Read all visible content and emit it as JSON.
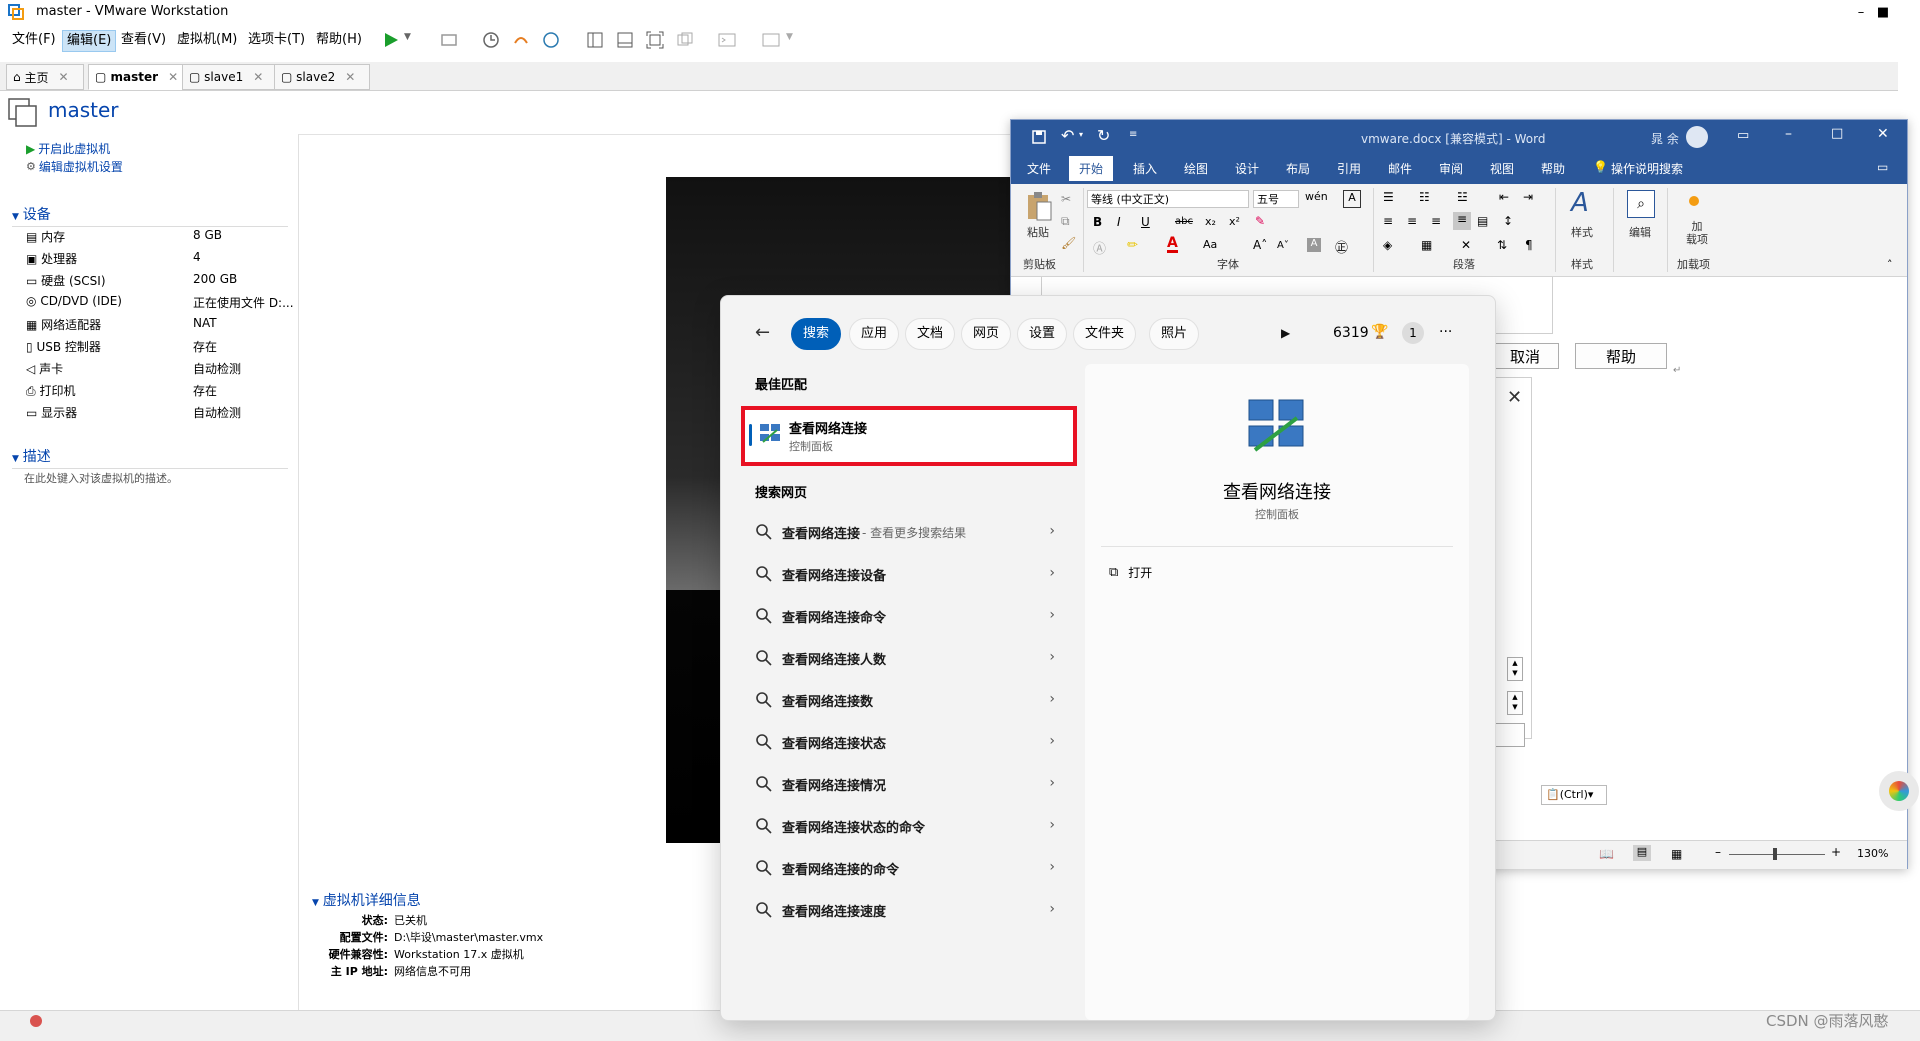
{
  "vmware": {
    "title": "master - VMware Workstation",
    "menu": [
      "文件(F)",
      "编辑(E)",
      "查看(V)",
      "虚拟机(M)",
      "选项卡(T)",
      "帮助(H)"
    ],
    "tabs": [
      "主页",
      "master",
      "slave1",
      "slave2"
    ],
    "vm_name": "master",
    "actions": [
      "开启此虚拟机",
      "编辑虚拟机设置"
    ],
    "devices_title": "设备",
    "devices": [
      {
        "name": "内存",
        "value": "8 GB"
      },
      {
        "name": "处理器",
        "value": "4"
      },
      {
        "name": "硬盘 (SCSI)",
        "value": "200 GB"
      },
      {
        "name": "CD/DVD (IDE)",
        "value": "正在使用文件 D:..."
      },
      {
        "name": "网络适配器",
        "value": "NAT"
      },
      {
        "name": "USB 控制器",
        "value": "存在"
      },
      {
        "name": "声卡",
        "value": "自动检测"
      },
      {
        "name": "打印机",
        "value": "存在"
      },
      {
        "name": "显示器",
        "value": "自动检测"
      }
    ],
    "desc_title": "描述",
    "desc_placeholder": "在此处键入对该虚拟机的描述。",
    "details_title": "虚拟机详细信息",
    "details": [
      {
        "label": "状态:",
        "value": "已关机"
      },
      {
        "label": "配置文件:",
        "value": "D:\\毕设\\master\\master.vmx"
      },
      {
        "label": "硬件兼容性:",
        "value": "Workstation 17.x 虚拟机"
      },
      {
        "label": "主 IP 地址:",
        "value": "网络信息不可用"
      }
    ]
  },
  "word": {
    "title": "vmware.docx [兼容模式] - Word",
    "user": "晁 余",
    "tabs": [
      "文件",
      "开始",
      "插入",
      "绘图",
      "设计",
      "布局",
      "引用",
      "邮件",
      "审阅",
      "视图",
      "帮助"
    ],
    "tell_me": "操作说明搜索",
    "font_name": "等线 (中文正文)",
    "font_size": "五号",
    "format_btns": [
      "B",
      "I",
      "U",
      "abc",
      "x₂",
      "x²"
    ],
    "paste_label": "粘贴",
    "style_label": "样式",
    "edit_label": "编辑",
    "addin_label": "加\n载项",
    "groups": [
      "剪贴板",
      "字体",
      "段落",
      "样式",
      "加载项"
    ],
    "dialog_cancel": "取消",
    "dialog_help": "帮助",
    "paste_ctrl": "(Ctrl)",
    "zoom": "130%"
  },
  "search": {
    "filters": [
      "搜索",
      "应用",
      "文档",
      "网页",
      "设置",
      "文件夹",
      "照片"
    ],
    "points": "6319",
    "badge": "1",
    "best_match_title": "最佳匹配",
    "best_match": {
      "title": "查看网络连接",
      "subtitle": "控制面板"
    },
    "web_title": "搜索网页",
    "web_results": [
      {
        "text": "查看网络连接",
        "suffix": "- 查看更多搜索结果"
      },
      {
        "text": "查看网络连接设备",
        "suffix": ""
      },
      {
        "text": "查看网络连接命令",
        "suffix": ""
      },
      {
        "text": "查看网络连接人数",
        "suffix": ""
      },
      {
        "text": "查看网络连接数",
        "suffix": ""
      },
      {
        "text": "查看网络连接状态",
        "suffix": ""
      },
      {
        "text": "查看网络连接情况",
        "suffix": ""
      },
      {
        "text": "查看网络连接状态的命令",
        "suffix": ""
      },
      {
        "text": "查看网络连接的命令",
        "suffix": ""
      },
      {
        "text": "查看网络连接速度",
        "suffix": ""
      }
    ],
    "detail_title": "查看网络连接",
    "detail_subtitle": "控制面板",
    "open_label": "打开"
  },
  "watermark": "CSDN @雨落风憨",
  "colors": {
    "word_blue": "#2b579a",
    "search_accent": "#005fb8",
    "highlight_red": "#e81123",
    "link_blue": "#0645ad"
  }
}
